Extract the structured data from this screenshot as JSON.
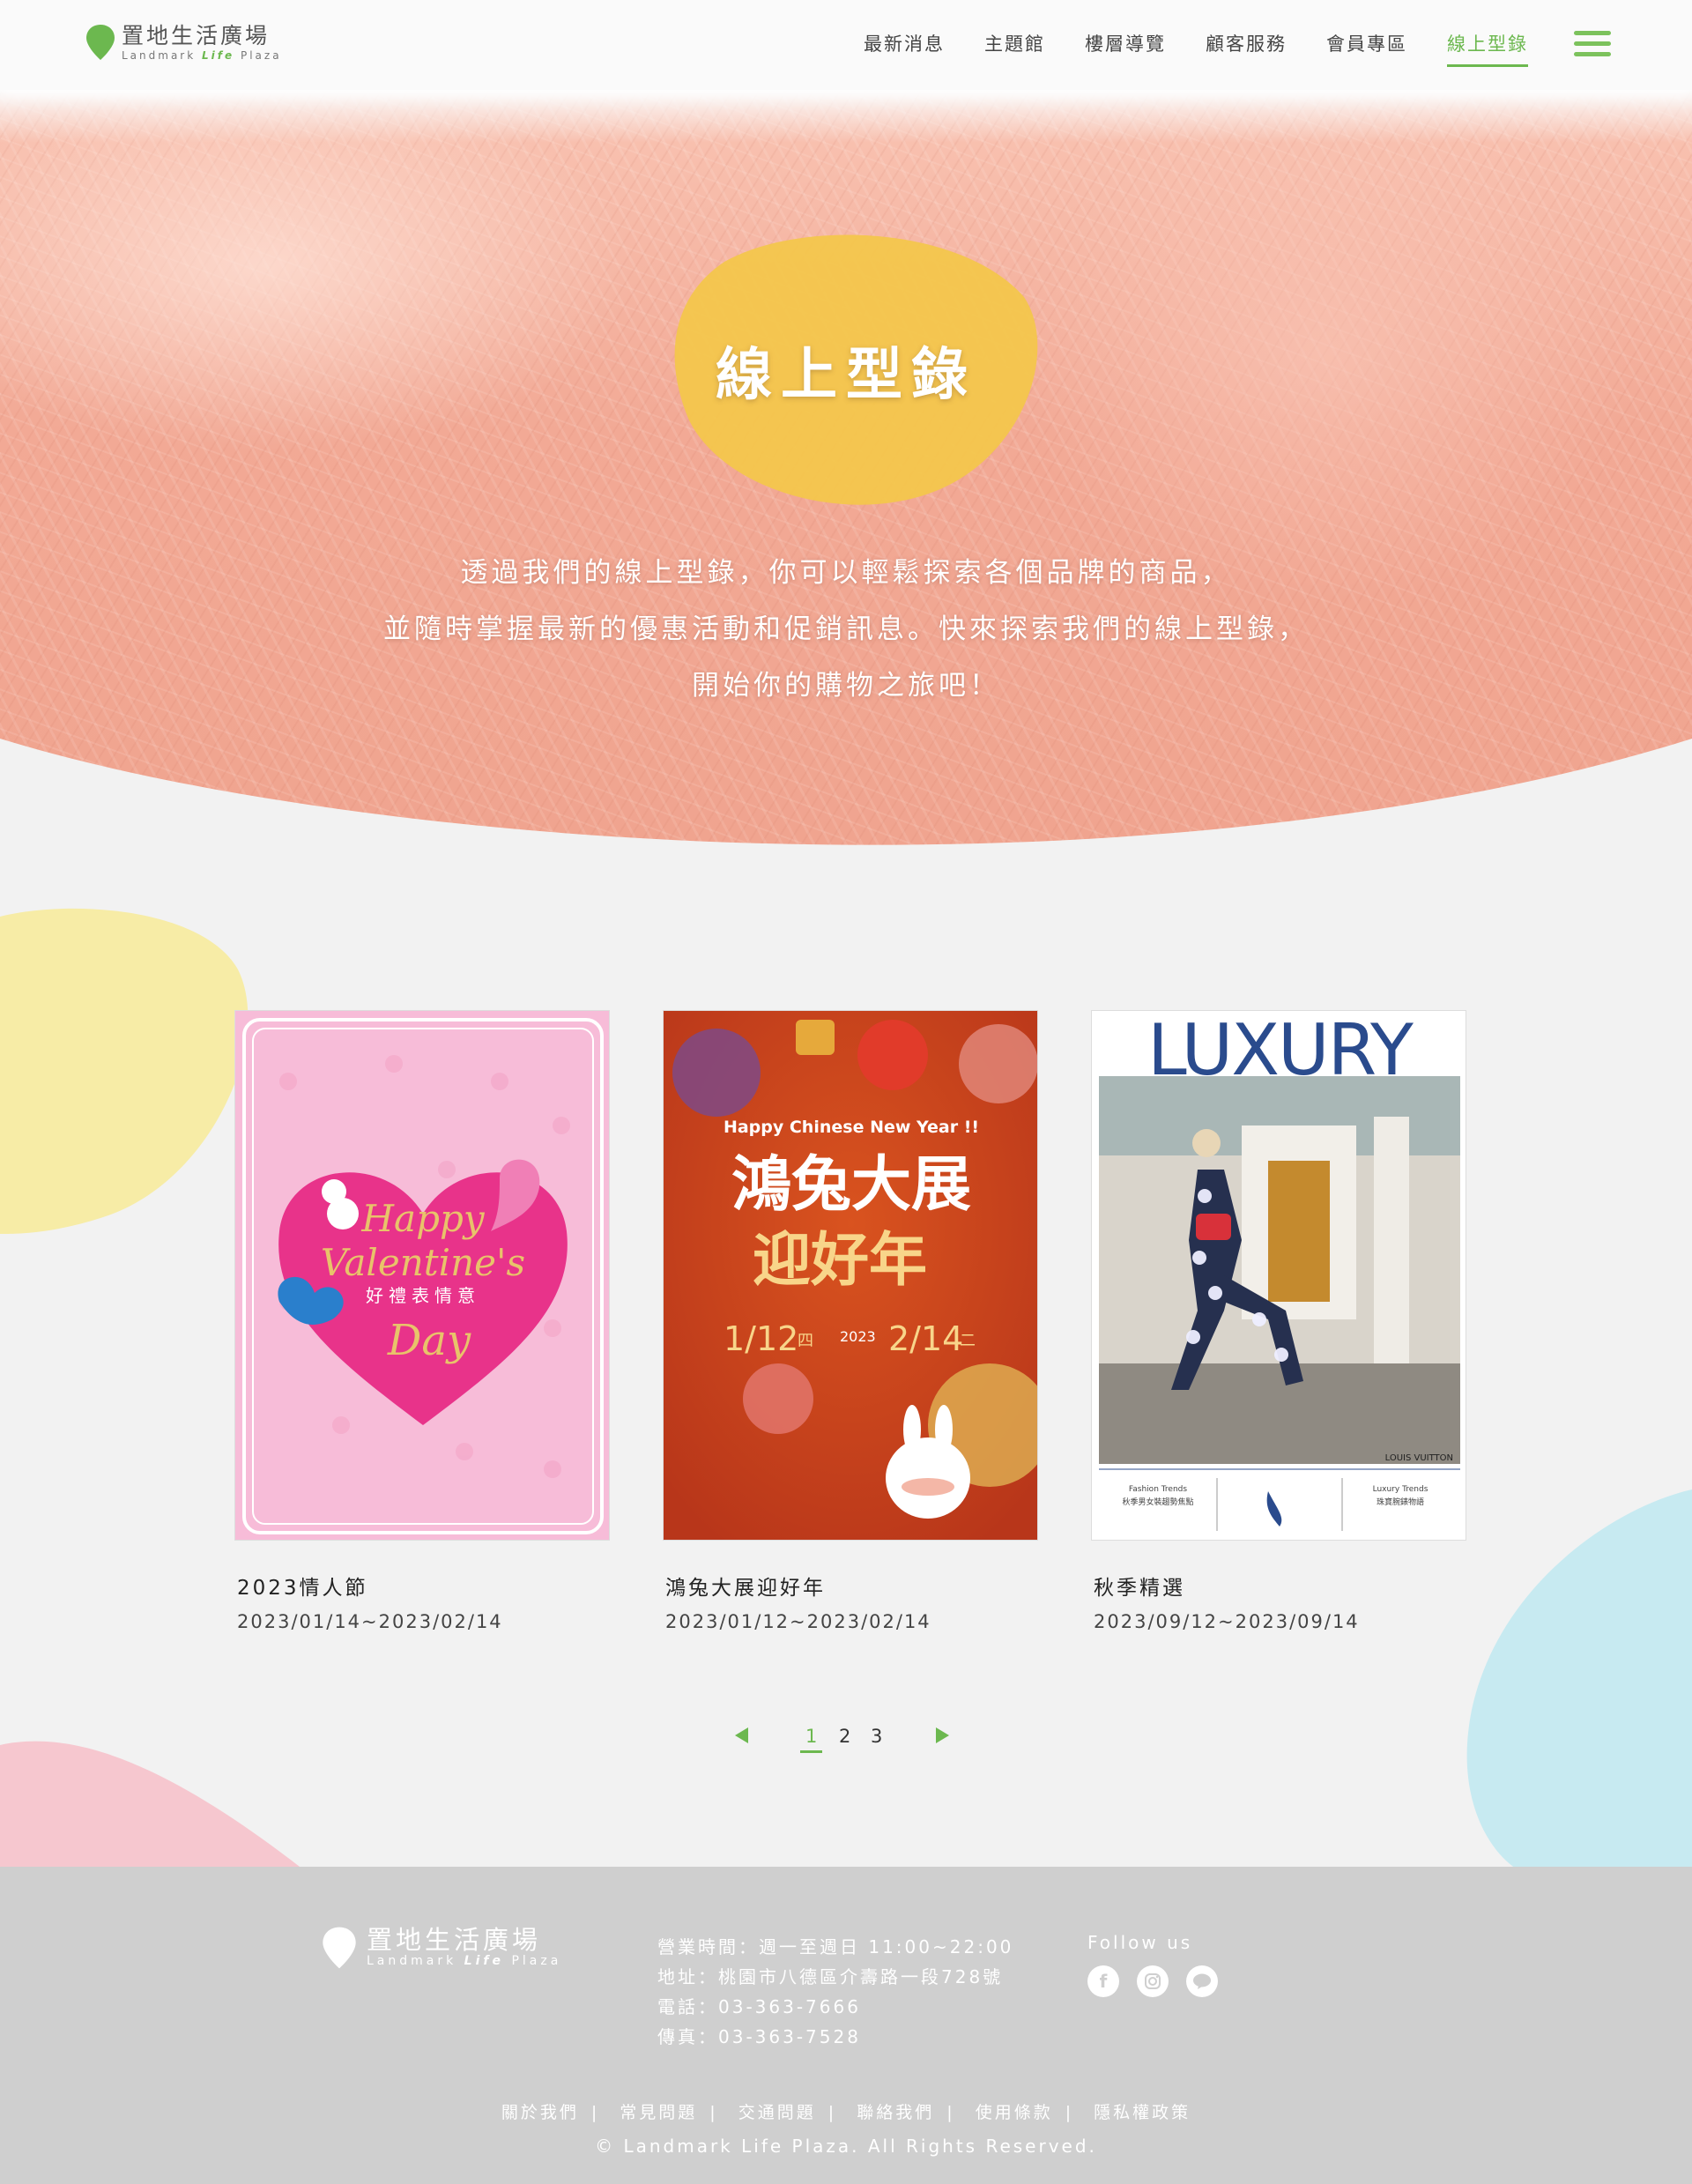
{
  "header": {
    "logo_cn": "置地生活廣場",
    "logo_en_pre": "Landmark",
    "logo_en_life": "Life",
    "logo_en_post": "Plaza",
    "nav": [
      "最新消息",
      "主題館",
      "樓層導覽",
      "顧客服務",
      "會員專區",
      "線上型錄"
    ],
    "active_nav": "線上型錄"
  },
  "hero": {
    "title": "線上型錄",
    "desc_lines": [
      "透過我們的線上型錄，你可以輕鬆探索各個品牌的商品，",
      "並隨時掌握最新的優惠活動和促銷訊息。快來探索我們的線上型錄，",
      "開始你的購物之旅吧！"
    ]
  },
  "catalogs": [
    {
      "title": "2023情人節",
      "date": "2023/01/14~2023/02/14",
      "cover": {
        "line1": "Happy",
        "line2": "Valentine's",
        "line3": "Day",
        "sub": "好禮表情意"
      }
    },
    {
      "title": "鴻兔大展迎好年",
      "date": "2023/01/12~2023/02/14",
      "cover": {
        "top": "Happy Chinese New Year !!",
        "line1": "鴻兔大展",
        "line2": "迎好年",
        "start": "1/12",
        "start_day": "四",
        "year": "2023",
        "end": "2/14",
        "end_day": "二"
      }
    },
    {
      "title": "秋季精選",
      "date": "2023/09/12~2023/09/14",
      "cover": {
        "masthead": "LUXURY",
        "brand": "LOUIS VUITTON",
        "left_head": "Fashion Trends",
        "left_sub": "秋季男女裝趨勢焦點",
        "right_head": "Luxury Trends",
        "right_sub": "珠寶腕錶物語"
      }
    }
  ],
  "pagination": {
    "pages": [
      "1",
      "2",
      "3"
    ],
    "current": "1"
  },
  "footer": {
    "logo_cn": "置地生活廣場",
    "logo_en_pre": "Landmark",
    "logo_en_life": "Life",
    "logo_en_post": "Plaza",
    "hours": "營業時間：週一至週日 11:00~22:00",
    "address": "地址：桃園市八德區介壽路一段728號",
    "phone": "電話：03-363-7666",
    "fax": "傳真：03-363-7528",
    "follow": "Follow us",
    "social": [
      "facebook-icon",
      "instagram-icon",
      "line-icon"
    ],
    "links": [
      "關於我們",
      "常見問題",
      "交通問題",
      "聯絡我們",
      "使用條款",
      "隱私權政策"
    ],
    "copyright": "© Landmark Life Plaza. All Rights Reserved."
  },
  "colors": {
    "accent": "#6cb84f",
    "hero_blob": "#f3c64c",
    "footer": "#cfcfcf",
    "blob_yellow": "#f7eca6",
    "blob_pink": "#f6c7cf",
    "blob_blue": "#c7eaf1"
  }
}
